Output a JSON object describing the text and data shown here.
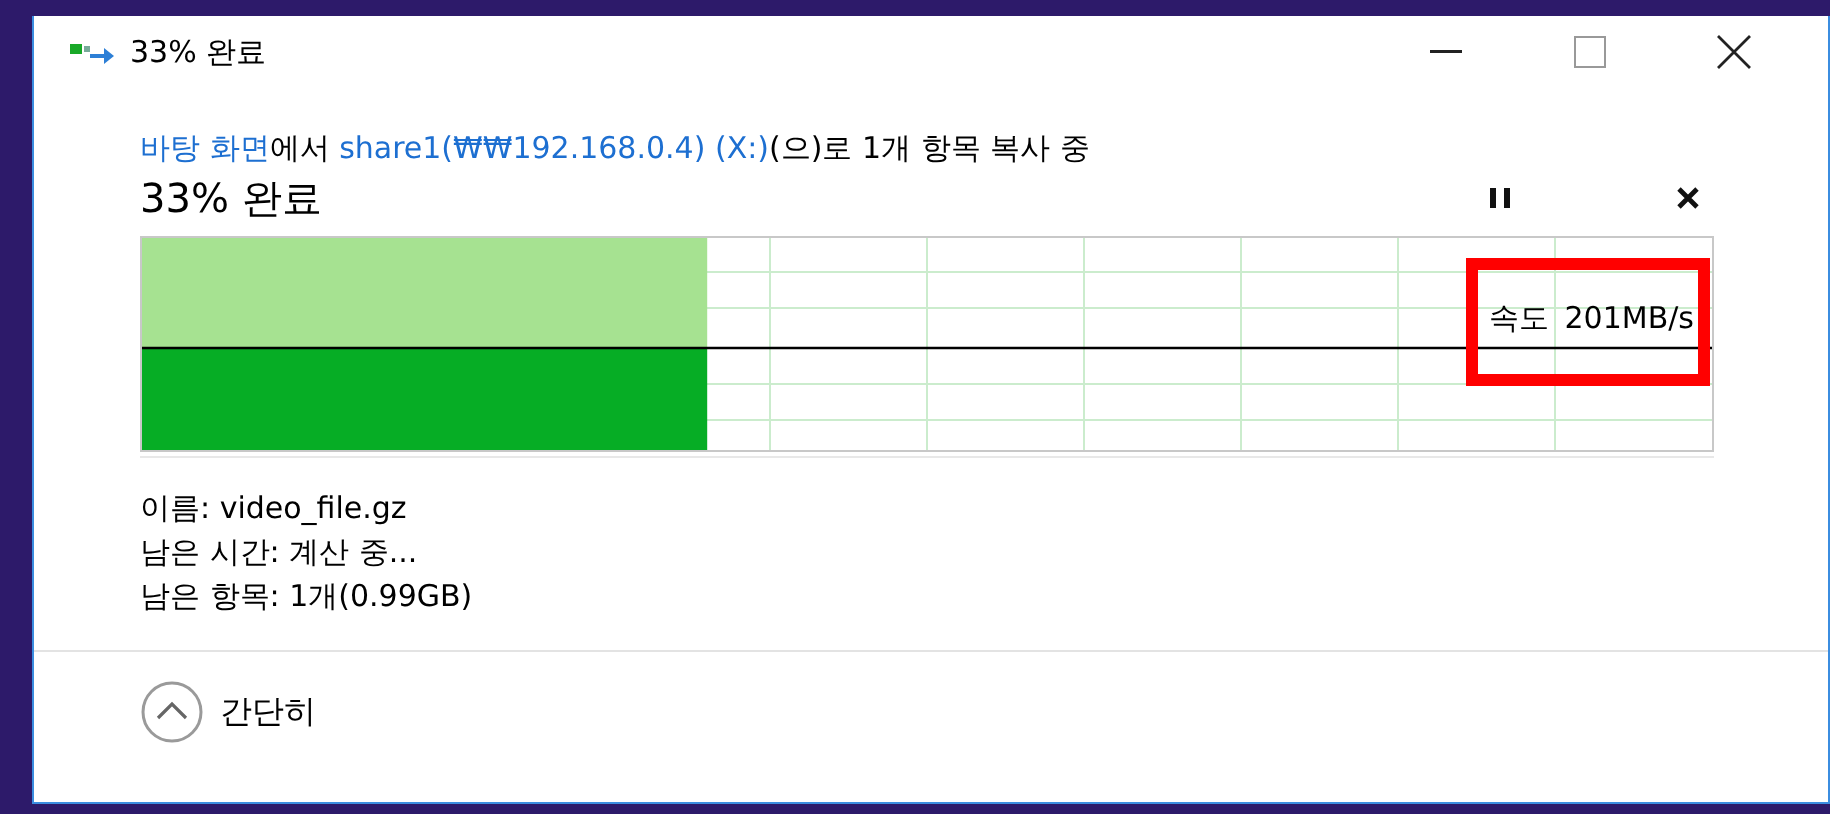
{
  "window": {
    "title": "33% 완료"
  },
  "transfer": {
    "description": [
      {
        "kind": "link",
        "text": "바탕 화면"
      },
      {
        "kind": "text",
        "text": "에서 "
      },
      {
        "kind": "link",
        "text": "share1(₩₩192.168.0.4) (X:)"
      },
      {
        "kind": "text",
        "text": "(으)로 1개 항목 복사 중"
      }
    ],
    "heading": "33% 완료",
    "level": 0.36,
    "speed_label": "속도",
    "speed": "201MB/s",
    "speed_highlighted": true
  },
  "details": [
    "이름: video_file.gz",
    "남은 시간: 계산 중...",
    "남은 항목: 1개(0.99GB)"
  ],
  "footer": {
    "toggle": "간단히",
    "expanded": true
  }
}
